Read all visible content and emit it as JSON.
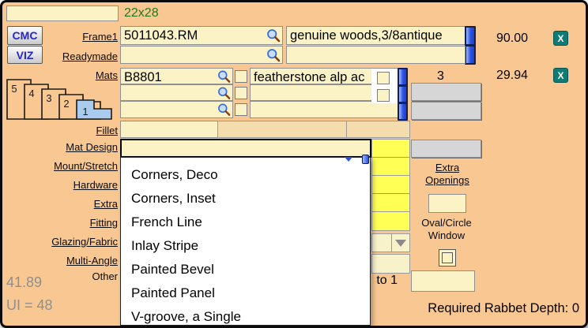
{
  "window": {
    "size_field_value": "",
    "dimensions_label": "22x28"
  },
  "toolbar": {
    "cmc_label": "CMC",
    "viz_label": "VIZ"
  },
  "labels": {
    "frame1": "Frame1",
    "readymade": "Readymade",
    "mats": "Mats",
    "fillet": "Fillet",
    "mat_design": "Mat Design",
    "mount_stretch": "Mount/Stretch",
    "hardware": "Hardware",
    "extra": "Extra",
    "fitting": "Fitting",
    "glazing_fabric": "Glazing/Fabric",
    "multi_angle": "Multi-Angle",
    "other": "Other"
  },
  "frame1": {
    "code": "5011043.RM",
    "description": "genuine woods,3/8antique",
    "price": "90.00",
    "remove_label": "X"
  },
  "readymade": {
    "code": "",
    "description": ""
  },
  "mats": {
    "rows": [
      {
        "code": "B8801",
        "description": "featherstone alp ac"
      },
      {
        "code": "",
        "description": ""
      },
      {
        "code": "",
        "description": ""
      }
    ],
    "quantity": "3",
    "price": "29.94",
    "remove_label": "X",
    "thumbnails": [
      "5",
      "4",
      "3",
      "2",
      "1"
    ]
  },
  "mat_design": {
    "value": "",
    "dropdown_items": [
      "Corners, Deco",
      "Corners, Inset",
      "French Line",
      "Inlay Stripe",
      "Painted Bevel",
      "Painted Panel",
      "V-groove, a Single"
    ]
  },
  "right_panel": {
    "extra_openings_line1": "Extra",
    "extra_openings_line2": "Openings",
    "extra_openings_value": "",
    "oval_circle_line1": "Oval/Circle",
    "oval_circle_line2": "Window",
    "other_ratio_label": "to 1",
    "other_value": ""
  },
  "totals": {
    "price_total": "41.89",
    "united_inches": "UI = 48",
    "rabbet_depth": "Required Rabbet Depth: 0"
  },
  "colors": {
    "background_peach": "#F9C892",
    "field_cream": "#FBF3C6",
    "highlight_yellow": "#FFFF55",
    "scrollbar_blue": "#2B50E4",
    "remove_teal": "#0E7C74",
    "dimensions_green": "#1E7A1E",
    "muted_gray_text": "#8F8F8F"
  }
}
